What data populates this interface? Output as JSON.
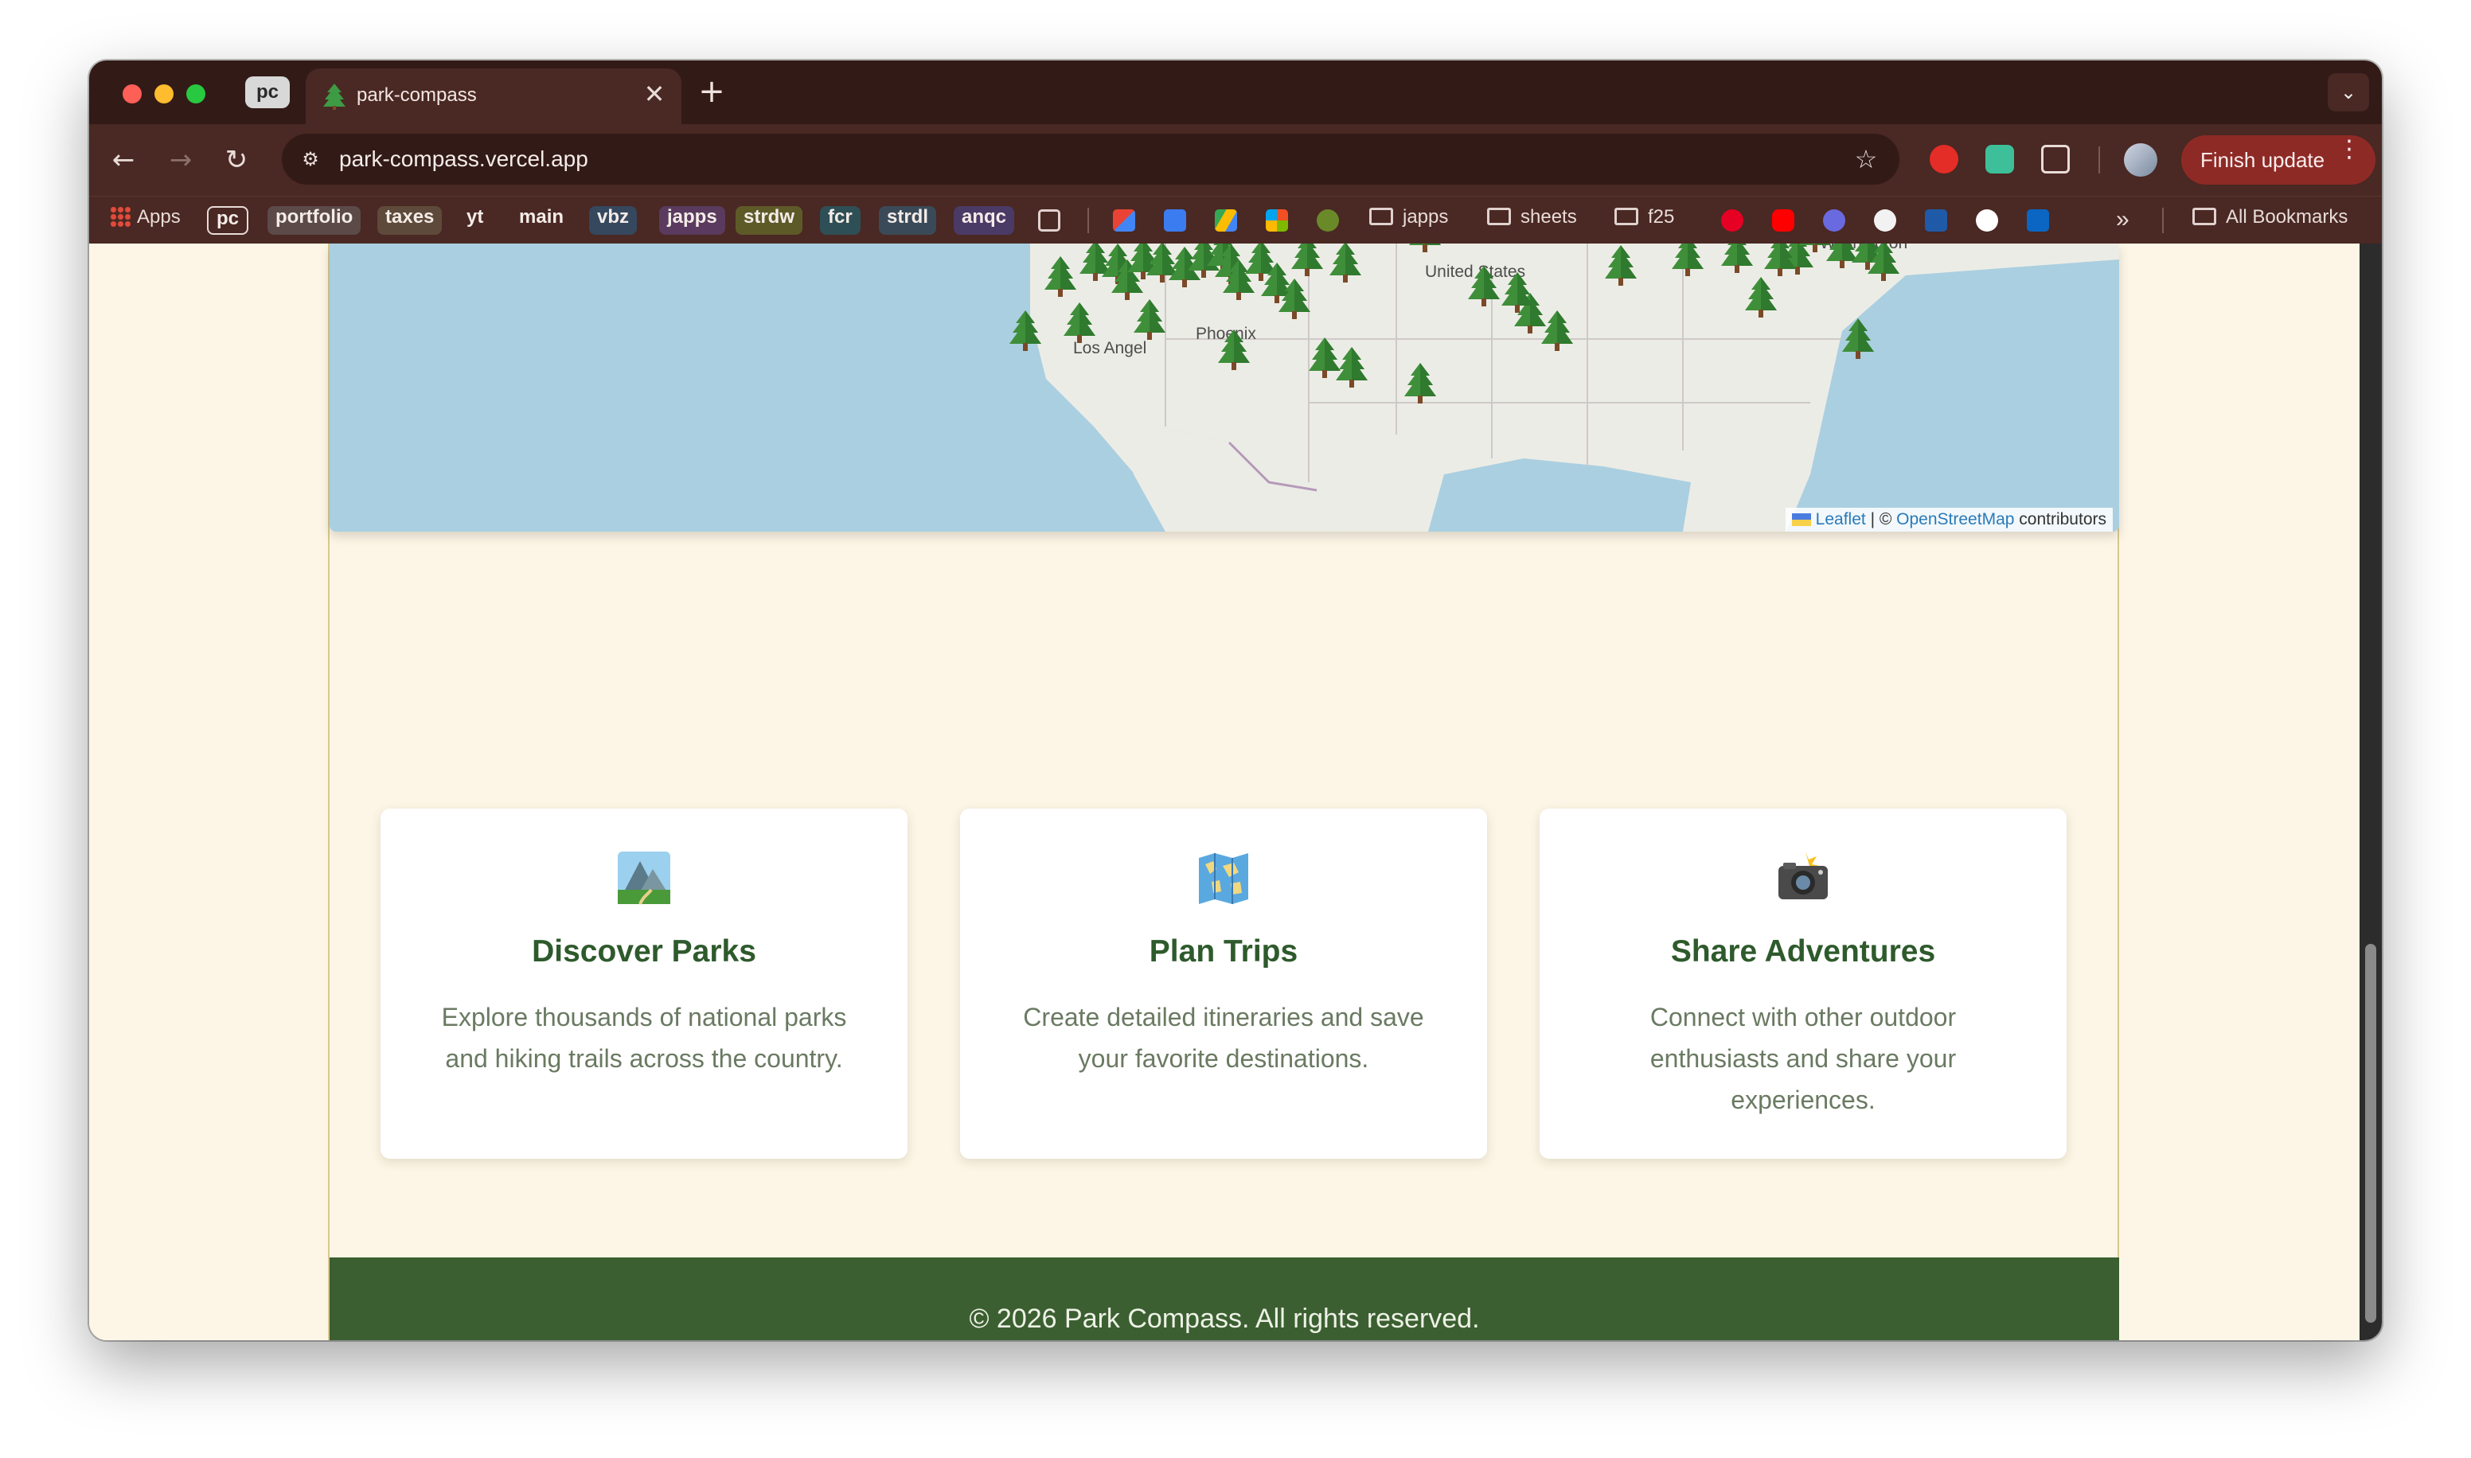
{
  "browser": {
    "tab_group_label": "pc",
    "tab_title": "park-compass",
    "tab_close_glyph": "✕",
    "new_tab_glyph": "+",
    "tab_search_glyph": "⌄",
    "url": "park-compass.vercel.app",
    "finish_update_label": "Finish update",
    "bookmarks": {
      "apps_label": "Apps",
      "chips": [
        {
          "label": "pc",
          "color": "#6b4a44"
        },
        {
          "label": "portfolio",
          "color": "#5b4a48"
        },
        {
          "label": "taxes",
          "color": "#5e4a3a"
        },
        {
          "label": "yt",
          "color": "#4a2823"
        },
        {
          "label": "main",
          "color": "#4a2823"
        },
        {
          "label": "vbz",
          "color": "#35485e"
        },
        {
          "label": "japps",
          "color": "#5a3a5e"
        },
        {
          "label": "strdw",
          "color": "#5e5a28"
        },
        {
          "label": "fcr",
          "color": "#2e4f55"
        },
        {
          "label": "strdl",
          "color": "#3a4a58"
        },
        {
          "label": "anqc",
          "color": "#4a3a66"
        }
      ],
      "folders": [
        "japps",
        "sheets",
        "f25"
      ],
      "overflow_glyph": "»",
      "all_bookmarks_label": "All Bookmarks"
    }
  },
  "map": {
    "labels": {
      "country": "United States",
      "city1": "Phoenix",
      "city2": "Los Angeles",
      "city3": "Washington"
    },
    "attribution": {
      "leaflet": "Leaflet",
      "separator": " | © ",
      "osm": "OpenStreetMap",
      "suffix": " contributors"
    }
  },
  "features": [
    {
      "icon": "national-park-icon",
      "title": "Discover Parks",
      "description": "Explore thousands of national parks and hiking trails across the country."
    },
    {
      "icon": "world-map-icon",
      "title": "Plan Trips",
      "description": "Create detailed itineraries and save your favorite destinations."
    },
    {
      "icon": "camera-flash-icon",
      "title": "Share Adventures",
      "description": "Connect with other outdoor enthusiasts and share your experiences."
    }
  ],
  "footer": {
    "copyright": "© 2026 Park Compass. All rights reserved."
  },
  "colors": {
    "page_bg": "#fdf6e6",
    "brand_green": "#3b5f31",
    "title_green": "#2e5a2c",
    "browser_dark": "#321a17",
    "browser_toolbar": "#4a2823",
    "update_red": "#8e2a25"
  }
}
